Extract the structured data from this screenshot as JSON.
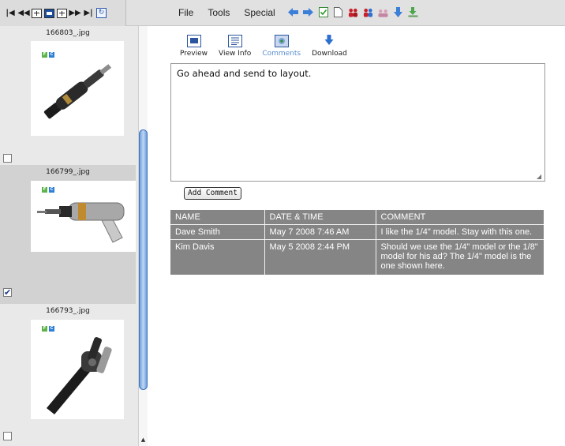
{
  "nav": {
    "buttons": [
      "first-page",
      "previous-page",
      "list-view",
      "thumbnail-view",
      "grid-view",
      "next-page",
      "last-page",
      "refresh"
    ]
  },
  "menu": {
    "items": [
      "File",
      "Tools",
      "Special"
    ]
  },
  "toolbar": {
    "icons": [
      "back-arrow",
      "forward-arrow",
      "checklist",
      "blank-page",
      "red-people",
      "red-blue-people",
      "group",
      "download-arrow",
      "green-download"
    ]
  },
  "thumbnails": [
    {
      "filename": "166803_.jpg",
      "checked": false,
      "selected": false,
      "badges": [
        "F",
        "C"
      ]
    },
    {
      "filename": "166799_.jpg",
      "checked": true,
      "selected": true,
      "badges": [
        "F",
        "C"
      ]
    },
    {
      "filename": "166793_.jpg",
      "checked": false,
      "selected": false,
      "badges": [
        "F",
        "C"
      ]
    }
  ],
  "actions": {
    "preview": "Preview",
    "view_info": "View Info",
    "comments": "Comments",
    "download": "Download"
  },
  "comment_input": {
    "value": "Go ahead and send to layout."
  },
  "add_comment_label": "Add Comment",
  "comments_table": {
    "headers": [
      "NAME",
      "DATE & TIME",
      "COMMENT"
    ],
    "rows": [
      {
        "name": "Dave Smith",
        "datetime": "May 7 2008  7:46 AM",
        "comment": "I like the 1/4\" model. Stay with this one."
      },
      {
        "name": "Kim Davis",
        "datetime": "May 5 2008  2:44 PM",
        "comment": "Should we use the 1/4\" model or the 1/8\" model for his ad? The 1/4\" model is the one shown here."
      }
    ]
  },
  "colors": {
    "table_bg": "#858585",
    "accent_blue": "#2c55a0",
    "scroll_blue": "#6e9fdc"
  }
}
